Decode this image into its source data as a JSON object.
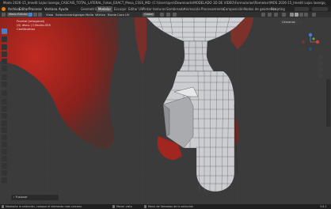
{
  "titlebar": {
    "text": "Modo 2026-15_Imedit Lojas lasergo_CASCAIS_TOTAL_LATERAL_Fotos_EXACT_Mesa_CSSS_MD: (C:\\Users\\ipro\\Downloads\\MODELADO 3D DE VIDEO\\Formularios\\Ramelarr\\MOS 2026-15_Imedit Lojas lasergo_CASCAIS_MEDIO.blend) - Blender 3.6.1"
  },
  "menubar": {
    "items": [
      "Archivo",
      "Editar",
      "Procesar",
      "Ventana",
      "Ayuda"
    ],
    "tabs": [
      "Geometría",
      "Modelar",
      "Esculpir",
      "Editar UV",
      "Pintar texturas",
      "Sombreado",
      "Animación",
      "Procesamiento",
      "Composición",
      "Nodos de geometría",
      "Scripting"
    ],
    "active_tab": "Modelar"
  },
  "header": {
    "mode_label": "Modo Edición",
    "menus": [
      "Vista",
      "Seleccionar",
      "Agregar",
      "Malla",
      "Vértice",
      "Borde",
      "Cara",
      "UV"
    ],
    "orientation_label": "Global",
    "snap_label": "Cercanos"
  },
  "viewport": {
    "info_lines": [
      "Frontal (ortogonal)",
      "(0) disco | Cilindro.055",
      "Centímetros"
    ]
  },
  "last_operator": {
    "label": "› Fusionar"
  },
  "statusbar": {
    "left": "Mediante la selección, coloque el elemento más cercano",
    "mid1": "Mover vista",
    "mid2": "Menú de llamadas de la selección",
    "version": "3.6.1"
  },
  "colors": {
    "accent": "#4f7fc3",
    "red_reference": "#b3241c",
    "mesh_face": "#cfd1d4"
  }
}
